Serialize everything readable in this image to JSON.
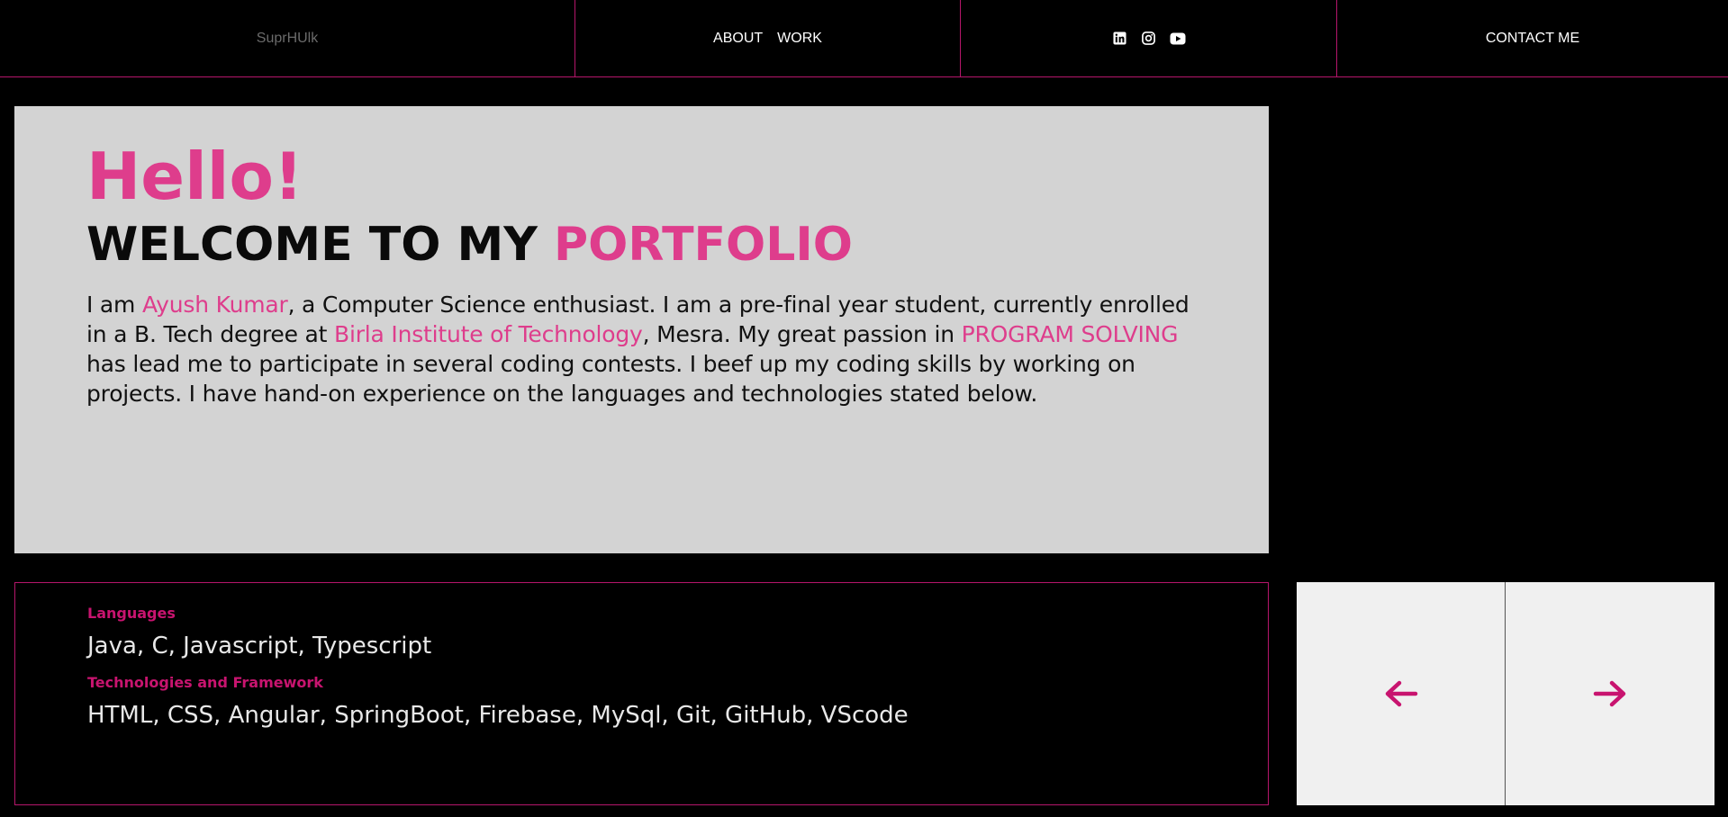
{
  "nav": {
    "brand": "SuprHUlk",
    "links": [
      {
        "label": "ABOUT"
      },
      {
        "label": "WORK"
      }
    ],
    "social_icons": [
      "linkedin-icon",
      "instagram-icon",
      "youtube-icon"
    ],
    "contact_label": "CONTACT ME"
  },
  "hero": {
    "hello": "Hello!",
    "title_prefix": "WELCOME TO MY ",
    "title_accent": "PORTFOLIO",
    "bio": {
      "p1": "I am ",
      "name": "Ayush Kumar",
      "p2": ", a Computer Science enthusiast. I am a pre-final year student, currently enrolled in a B. Tech degree at ",
      "institute": "Birla Institute of Technology",
      "p3": ", Mesra. My great passion in ",
      "passion": "PROGRAM SOLVING",
      "p4": " has lead me to participate in several coding contests. I beef up my coding skills by working on projects. I have hand-on experience on the languages and technologies stated below."
    }
  },
  "skills": {
    "languages_heading": "Languages",
    "languages_value": "Java, C, Javascript, Typescript",
    "tech_heading": "Technologies and Framework",
    "tech_value": "HTML, CSS, Angular, SpringBoot, Firebase, MySql, Git, GitHub, VScode"
  },
  "carousel": {
    "prev_icon": "arrow-left-icon",
    "next_icon": "arrow-right-icon"
  },
  "colors": {
    "accent_pink": "#de3d8c",
    "border_magenta": "#b5166b",
    "grid_start": "#7b2ff7",
    "grid_end": "#f0436a",
    "background": "#000000",
    "hero_bg": "#d3d3d3"
  }
}
